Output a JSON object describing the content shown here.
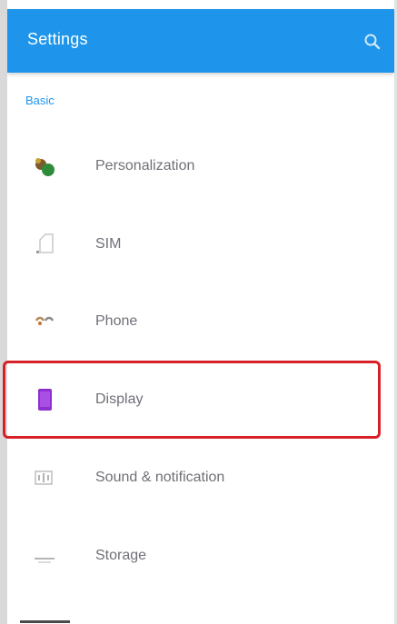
{
  "appbar": {
    "title": "Settings",
    "search_icon": "search-icon",
    "color": "#1e95ea"
  },
  "section": {
    "header": "Basic"
  },
  "settings_items": [
    {
      "label": "Personalization",
      "icon": "personalization-icon"
    },
    {
      "label": "SIM",
      "icon": "sim-icon"
    },
    {
      "label": "Phone",
      "icon": "phone-icon"
    },
    {
      "label": "Display",
      "icon": "display-icon",
      "highlighted": true
    },
    {
      "label": "Sound & notification",
      "icon": "sound-icon"
    },
    {
      "label": "Storage",
      "icon": "storage-icon"
    }
  ],
  "colors": {
    "highlight": "#d72128",
    "display_icon": "#8e2fd0"
  }
}
